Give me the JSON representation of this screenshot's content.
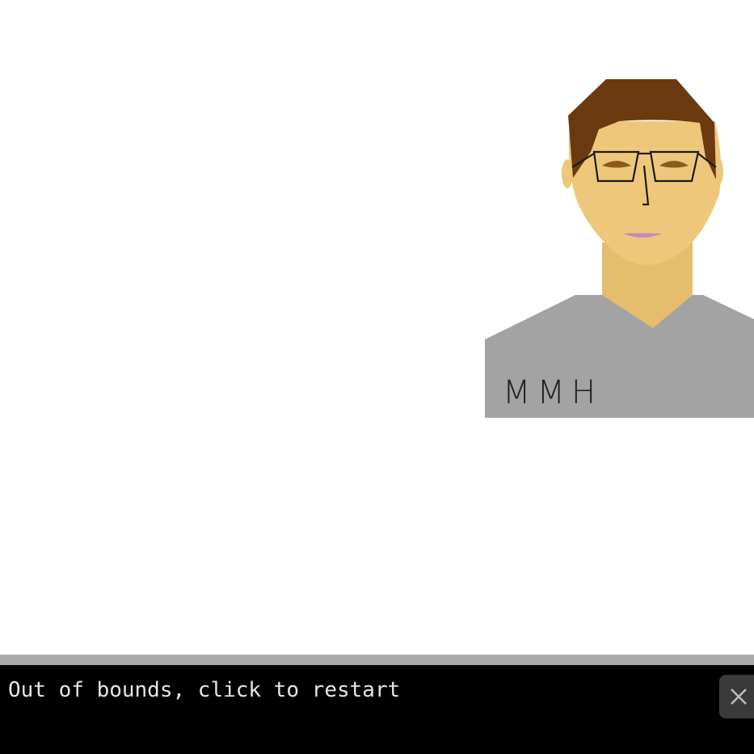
{
  "canvas": {
    "shirt_label": "MMH"
  },
  "console": {
    "message": "Out of bounds, click to restart",
    "close_icon": "close-icon"
  },
  "colors": {
    "hair": "#6b3a10",
    "skin": "#efc77a",
    "neck": "#e6bd6c",
    "shirt": "#a3a3a3",
    "lips": "#c58ab8",
    "eyes": "#8a5a1c",
    "console_bg": "#000000",
    "console_text": "#e6e6e6",
    "divider": "#aaaaaa"
  }
}
